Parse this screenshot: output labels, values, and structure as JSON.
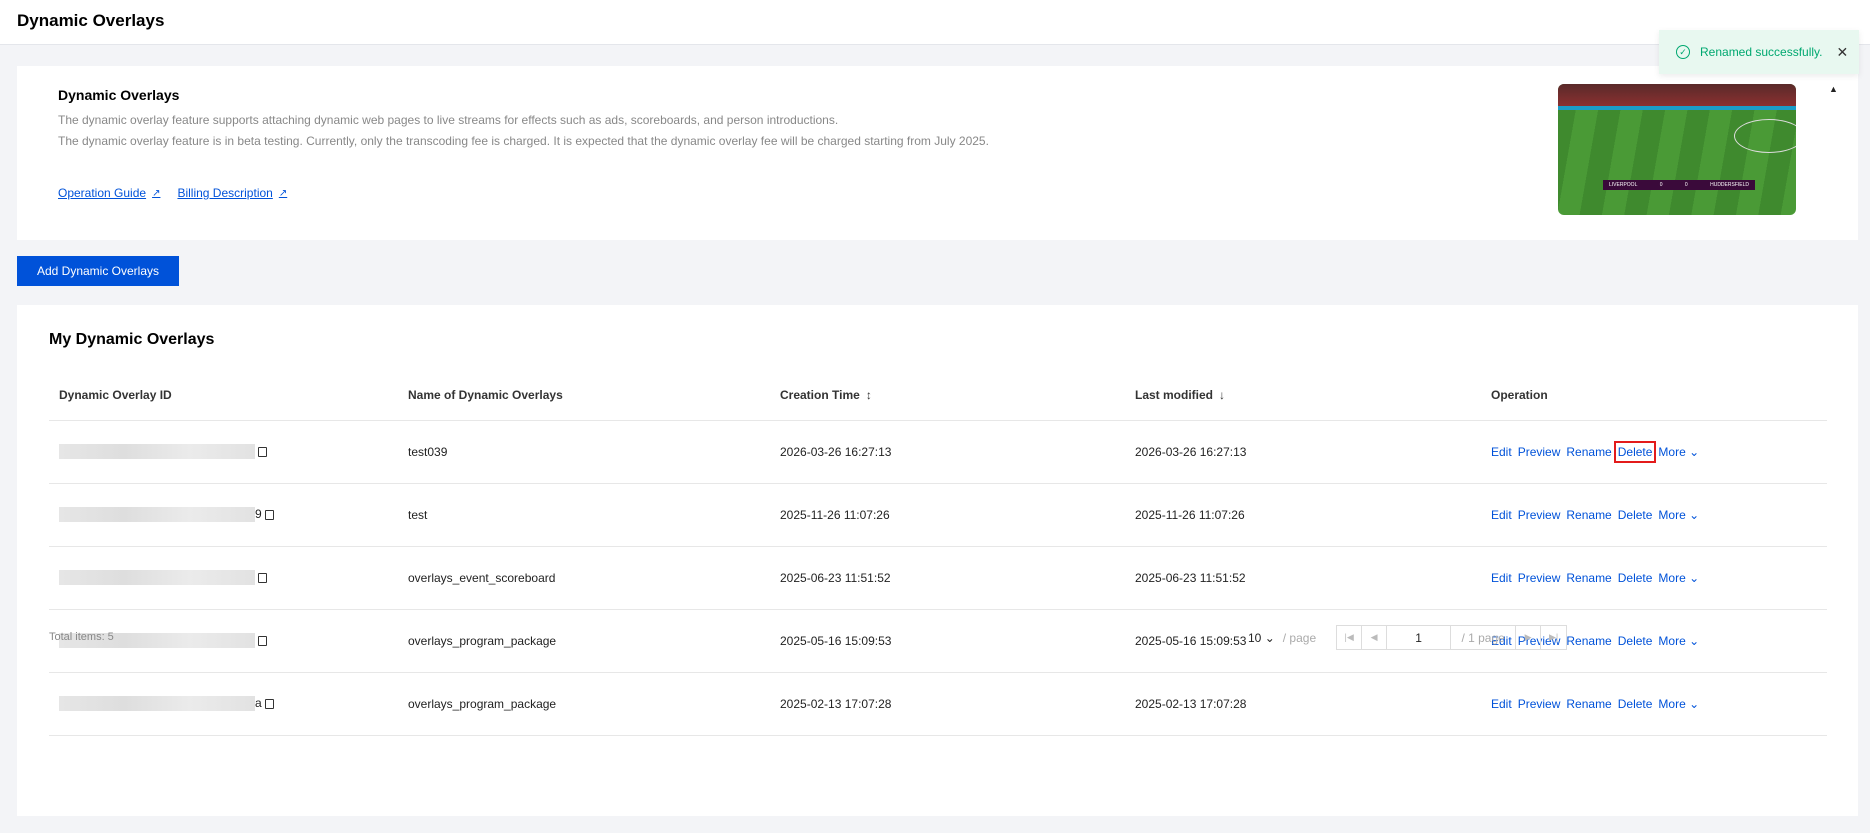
{
  "header": {
    "title": "Dynamic Overlays"
  },
  "toast": {
    "message": "Renamed successfully.",
    "close": "✕"
  },
  "info": {
    "title": "Dynamic Overlays",
    "line1": "The dynamic overlay feature supports attaching dynamic web pages to live streams for effects such as ads, scoreboards, and person introductions.",
    "line2": "The dynamic overlay feature is in beta testing. Currently, only the transcoding fee is charged. It is expected that the dynamic overlay fee will be charged starting from July 2025.",
    "links": [
      "Operation Guide",
      "Billing Description"
    ],
    "thumbnail": {
      "team_home": "LIVERPOOL",
      "team_away": "HUDDERSFIELD",
      "score_home": "0",
      "score_away": "0"
    }
  },
  "add_button": "Add Dynamic Overlays",
  "list": {
    "title": "My Dynamic Overlays",
    "columns": [
      "Dynamic Overlay ID",
      "Name of Dynamic Overlays",
      "Creation Time",
      "Last modified",
      "Operation"
    ],
    "rows": [
      {
        "id_visible": "",
        "name": "test039",
        "created": "2026-03-26 16:27:13",
        "modified": "2026-03-26 16:27:13"
      },
      {
        "id_visible": "9",
        "name": "test",
        "created": "2025-11-26 11:07:26",
        "modified": "2025-11-26 11:07:26"
      },
      {
        "id_visible": "",
        "name": "overlays_event_scoreboard",
        "created": "2025-06-23 11:51:52",
        "modified": "2025-06-23 11:51:52"
      },
      {
        "id_visible": "",
        "name": "overlays_program_package",
        "created": "2025-05-16 15:09:53",
        "modified": "2025-05-16 15:09:53"
      },
      {
        "id_visible": "a",
        "name": "overlays_program_package",
        "created": "2025-02-13 17:07:28",
        "modified": "2025-02-13 17:07:28"
      }
    ],
    "operations": [
      "Edit",
      "Preview",
      "Rename",
      "Delete",
      "More"
    ],
    "total": "Total items: 5",
    "pager": {
      "page_size": "10",
      "per_page": "/ page",
      "current": "1",
      "total_pages": "/ 1 page"
    }
  },
  "colors": {
    "accent": "#0052d9",
    "success": "#00a870"
  }
}
